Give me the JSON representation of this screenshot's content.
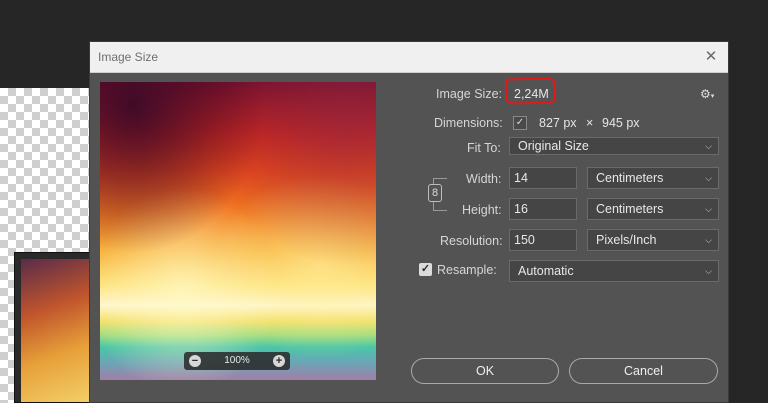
{
  "window": {
    "title": "Image Size",
    "close_symbol": "✕"
  },
  "preview": {
    "zoom": "100%",
    "zoom_out_symbol": "−",
    "zoom_in_symbol": "+"
  },
  "image_size": {
    "label": "Image Size:",
    "value": "2,24M"
  },
  "dimensions": {
    "label": "Dimensions:",
    "width": "827 px",
    "separator": "×",
    "height": "945 px"
  },
  "fit_to": {
    "label": "Fit To:",
    "value": "Original Size"
  },
  "width": {
    "label": "Width:",
    "value": "14",
    "unit": "Centimeters"
  },
  "height": {
    "label": "Height:",
    "value": "16",
    "unit": "Centimeters"
  },
  "resolution": {
    "label": "Resolution:",
    "value": "150",
    "unit": "Pixels/Inch"
  },
  "resample": {
    "label": "Resample:",
    "checked": true,
    "value": "Automatic"
  },
  "buttons": {
    "ok": "OK",
    "cancel": "Cancel"
  },
  "icons": {
    "gear": "⚙",
    "chevron": "⌵",
    "chain": "🔗",
    "check": "✓"
  },
  "colors": {
    "dialog_bg": "#535353",
    "highlight": "#e01a1a",
    "titlebar": "#f0f0f0"
  }
}
